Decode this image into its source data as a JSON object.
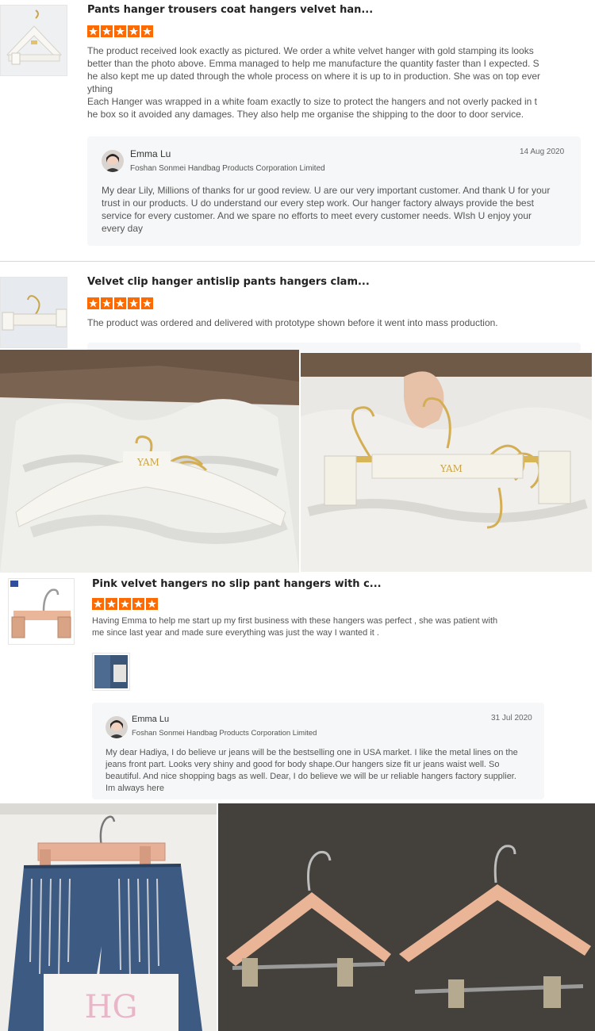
{
  "review1": {
    "title": "Pants hanger trousers coat hangers velvet han...",
    "rating": 5,
    "text_lines": [
      "The product received look exactly as pictured. We order a white velvet hanger with gold stamping its looks",
      "better than the photo above. Emma managed to help me manufacture the quantity faster than I expected. S",
      "he also kept me up dated through the whole process on where it is up to in production. She was on top ever",
      "ything",
      "Each Hanger was wrapped in a white foam exactly to size to protect the hangers and not overly packed in t",
      "he box so it avoided any damages. They also help me organise the shipping to the door to door service."
    ],
    "reply": {
      "name": "Emma Lu",
      "company": "Foshan Sonmei Handbag Products Corporation Limited",
      "date": "14 Aug 2020",
      "text_lines": [
        "My dear Lily, Millions of thanks for ur good review. U are our very important customer. And thank U for your",
        "trust in our products. U do understand our every step work. Our hanger factory always provide the best",
        "service for every customer. And we spare no efforts to meet every customer needs. WIsh U enjoy your",
        "every day"
      ]
    }
  },
  "review2": {
    "title": "Velvet clip hanger antislip pants hangers clam...",
    "rating": 5,
    "text": "The product was ordered and delivered with prototype shown before it went into mass production.",
    "photo_labels": [
      "YAM",
      "YAM"
    ]
  },
  "review3": {
    "title": "Pink velvet hangers no slip pant hangers with c...",
    "rating": 5,
    "text_lines": [
      "Having Emma to help me start up my first business with these hangers was perfect , she was patient with",
      "me since last year and made sure everything was just the way I wanted it ."
    ],
    "reply": {
      "name": "Emma Lu",
      "company": "Foshan Sonmei Handbag Products Corporation Limited",
      "date": "31 Jul 2020",
      "text_lines": [
        "My dear Hadiya, I do believe ur jeans will be the bestselling one in USA market. I like the metal lines on the",
        "jeans front part. Looks very shiny and good for body shape.Our hangers size fit ur jeans waist well. So",
        "beautiful. And nice shopping bags as well. Dear, I do believe we will be ur reliable hangers factory supplier.",
        "Im always here"
      ]
    }
  },
  "colors": {
    "star": "#ff6a00",
    "reply_bg": "#f6f7f8",
    "divider": "#d8d8d8",
    "hanger_pink": "#eab597"
  },
  "icons": [
    "star-icon",
    "avatar"
  ]
}
